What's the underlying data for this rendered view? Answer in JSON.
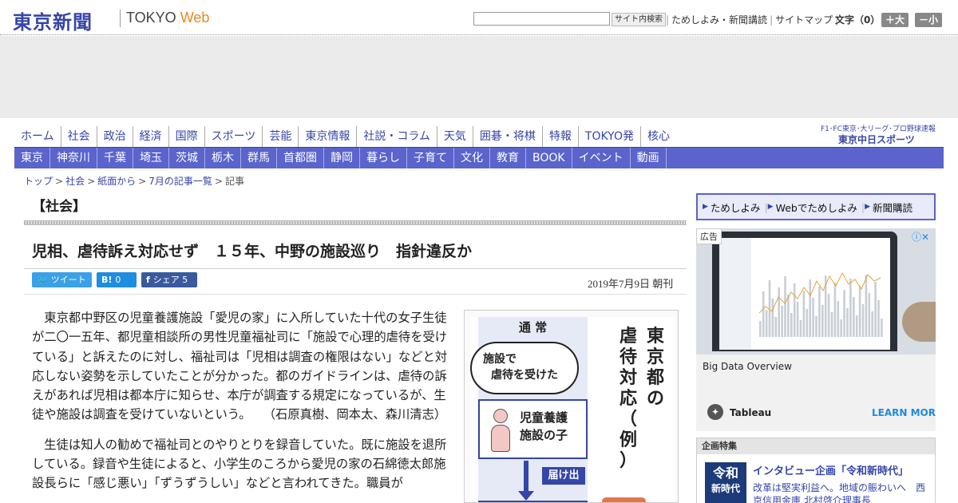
{
  "header": {
    "logo_jp": "東京新聞",
    "logo_en_a": "TOKYO",
    "logo_en_b": "Web",
    "search_button": "サイト内検索",
    "links": [
      "ためしよみ・新聞講読",
      "サイトマップ"
    ],
    "font_size_label": "文字（0）",
    "font_up": "＋大",
    "font_down": "－小"
  },
  "global_nav": [
    "ホーム",
    "社会",
    "政治",
    "経済",
    "国際",
    "スポーツ",
    "芸能",
    "東京情報",
    "社説・コラム",
    "天気",
    "囲碁・将棋",
    "特報",
    "TOKYO発",
    "核心"
  ],
  "chunichi": {
    "line1": "F1･FC東京･大リーグ･プロ野球速報",
    "line2": "東京中日スポーツ"
  },
  "region_nav": [
    "東京",
    "神奈川",
    "千葉",
    "埼玉",
    "茨城",
    "栃木",
    "群馬",
    "首都圏",
    "静岡",
    "暮らし",
    "子育て",
    "文化",
    "教育",
    "BOOK",
    "イベント",
    "動画"
  ],
  "breadcrumb": [
    "トップ",
    "社会",
    "紙面から",
    "7月の記事一覧"
  ],
  "breadcrumb_current": "記事",
  "section": "【社会】",
  "article": {
    "headline": "児相、虐待訴え対応せず　１５年、中野の施設巡り　指針違反か",
    "share": {
      "tweet": "ツイート",
      "hatena_icon": "B!",
      "hatena_count": "0",
      "facebook_label": "シェア",
      "facebook_count": "5"
    },
    "date": "2019年7月9日 朝刊",
    "paragraphs": [
      "東京都中野区の児童養護施設「愛児の家」に入所していた十代の女子生徒が二〇一五年、都児童相談所の男性児童福祉司に「施設で心理的虐待を受けている」と訴えたのに対し、福祉司は「児相は調査の権限はない」などと対応しない姿勢を示していたことが分かった。都のガイドラインは、虐待の訴えがあれば児相は都本庁に知らせ、本庁が調査する規定になっているが、生徒や施設は調査を受けていないという。　　（石原真樹、岡本太、森川清志）",
      "生徒は知人の勧めで福祉司とのやりとりを録音していた。既に施設を退所している。録音や生徒によると、小学生のころから愛児の家の石綿徳太郎施設長らに「感じ悪い」「ずうずうしい」などと言われてきた。職員が"
    ]
  },
  "figure": {
    "header": "通 常",
    "bubble_line1": "施設で",
    "bubble_line2": "虐待を受けた",
    "box_line1": "児童養護",
    "box_line2": "施設の子",
    "tag": "届け出",
    "title_col1": "東京都の",
    "title_col2": "虐待対応（例）"
  },
  "sidebar": {
    "subscribe": [
      "ためしよみ",
      "Webでためしよみ",
      "新聞購読"
    ],
    "ad": {
      "label": "広告",
      "info": "ⓘ✕",
      "title": "Big Data Overview",
      "brand": "Tableau",
      "cta": "LEARN MORE"
    },
    "feature": {
      "header": "企画特集",
      "thumb_a": "令和",
      "thumb_b": "新時代",
      "title": "インタビュー企画「令和新時代」",
      "desc": "改革は堅実利益へ。地域の賑わいへ　西京信用金庫 北村啓介理事長"
    }
  },
  "colors": {
    "brand": "#3545a8",
    "nav_bg": "#5a64cc",
    "twitter": "#3aa0e8",
    "hatena": "#1d8ee0",
    "facebook": "#3a5a9f"
  }
}
